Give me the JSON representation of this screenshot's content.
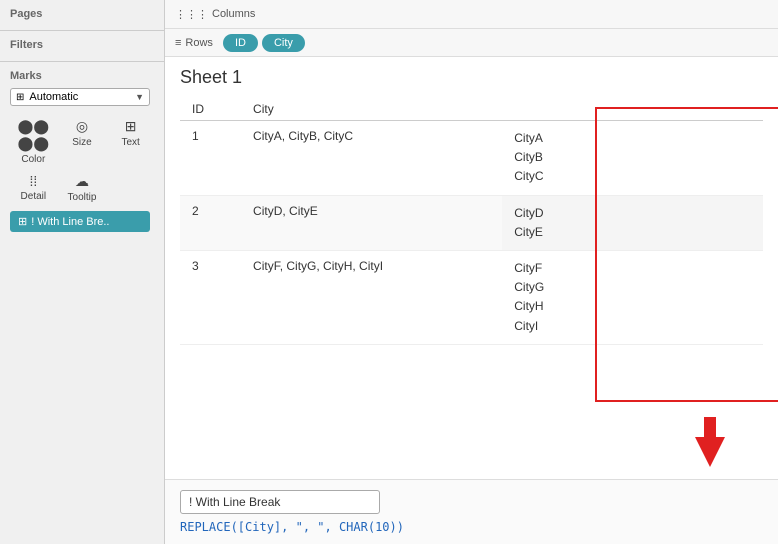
{
  "sidebar": {
    "pages_title": "Pages",
    "filters_title": "Filters",
    "marks_title": "Marks",
    "marks_dropdown": "Automatic",
    "marks_buttons": [
      {
        "icon": "⬤⬤",
        "label": "Color"
      },
      {
        "icon": "◎",
        "label": "Size"
      },
      {
        "icon": "⊞",
        "label": "Text"
      },
      {
        "icon": "⬡⬡",
        "label": "Detail"
      },
      {
        "icon": "⬜",
        "label": "Tooltip"
      }
    ],
    "with_line_break_label": "! With Line Bre.."
  },
  "toolbar": {
    "columns_icon": "⋮⋮⋮",
    "columns_label": "Columns",
    "rows_icon": "≡",
    "rows_label": "Rows",
    "id_pill": "ID",
    "city_pill": "City"
  },
  "sheet": {
    "title": "Sheet 1",
    "col_id": "ID",
    "col_city": "City",
    "rows": [
      {
        "id": "1",
        "city": "CityA, CityB, CityC",
        "lines": [
          "CityA",
          "CityB",
          "CityC"
        ]
      },
      {
        "id": "2",
        "city": "CityD, CityE",
        "lines": [
          "CityD",
          "CityE"
        ]
      },
      {
        "id": "3",
        "city": "CityF, CityG, CityH, CityI",
        "lines": [
          "CityF",
          "CityG",
          "CityH",
          "CityI"
        ]
      }
    ]
  },
  "bottom": {
    "formula_name": "! With Line Break",
    "formula_code": "REPLACE([City], \", \", CHAR(10))"
  },
  "colors": {
    "pill_bg": "#3a9dab",
    "highlight_border": "#e02020",
    "formula_color": "#2266bb"
  }
}
